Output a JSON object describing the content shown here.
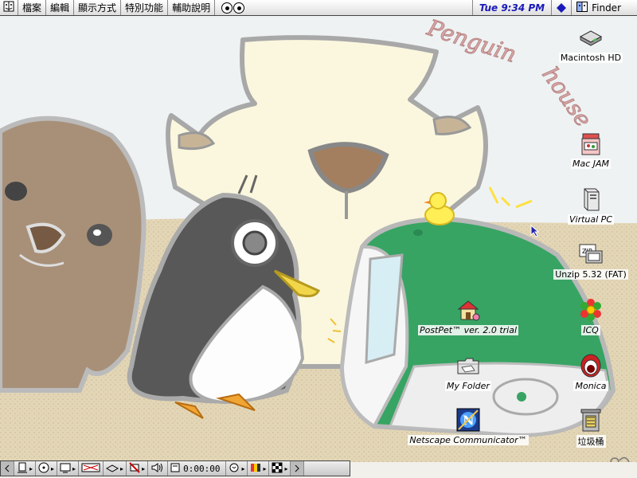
{
  "menubar": {
    "items": [
      {
        "label": "檔案"
      },
      {
        "label": "編輯"
      },
      {
        "label": "顯示方式"
      },
      {
        "label": "特別功能"
      },
      {
        "label": "輔助說明"
      }
    ],
    "clock": "Tue 9:34 PM",
    "app_name": "Finder"
  },
  "wallpaper": {
    "title_line1": "Penguin",
    "title_line2": "house"
  },
  "desktop_icons": [
    {
      "label": "Macintosh HD",
      "icon": "hard-drive-icon"
    },
    {
      "label": "Mac JAM",
      "icon": "jam-jar-icon"
    },
    {
      "label": "Virtual PC",
      "icon": "pc-tower-icon"
    },
    {
      "label": "Unzip 5.32 (FAT)",
      "icon": "unzip-icon"
    },
    {
      "label": "PostPet™ ver. 2.0 trial",
      "icon": "postpet-house-icon"
    },
    {
      "label": "ICQ",
      "icon": "icq-flower-icon"
    },
    {
      "label": "My Folder",
      "icon": "folder-icon"
    },
    {
      "label": "Monica",
      "icon": "monica-icon"
    },
    {
      "label": "Netscape Communicator™",
      "icon": "netscape-icon"
    },
    {
      "label": "垃圾桶",
      "icon": "trash-icon"
    }
  ],
  "control_strip": {
    "cd_time": "0:00:00"
  },
  "colors": {
    "menubar_clock": "#1a1ab8",
    "imac_green": "#3aa66a",
    "sand": "#ddd0b0",
    "sky": "#eef2f4"
  }
}
